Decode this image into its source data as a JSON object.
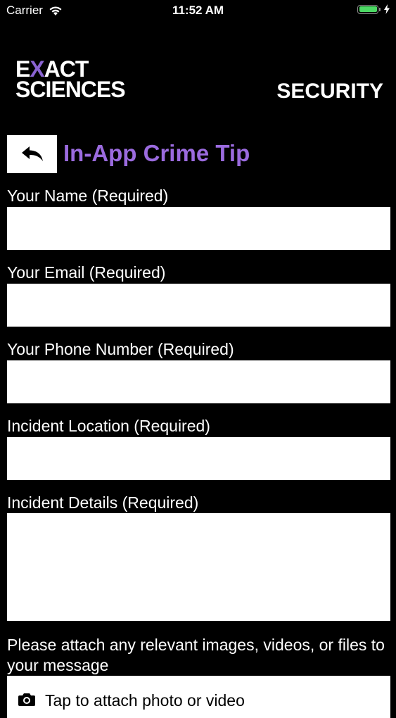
{
  "status_bar": {
    "carrier": "Carrier",
    "time": "11:52 AM",
    "battery_level": 1.0
  },
  "header": {
    "logo_line1_pre": "E",
    "logo_line1_x": "X",
    "logo_line1_post": "ACT",
    "logo_line2": "SCIENCES",
    "section": "SECURITY"
  },
  "page": {
    "back_icon": "reply-arrow-icon",
    "title": "In-App Crime Tip"
  },
  "form": {
    "name_label": "Your Name (Required)",
    "name_value": "",
    "email_label": "Your Email (Required)",
    "email_value": "",
    "phone_label": "Your Phone Number (Required)",
    "phone_value": "",
    "location_label": "Incident Location (Required)",
    "location_value": "",
    "details_label": "Incident Details (Required)",
    "details_value": "",
    "attach_note": "Please attach any relevant images, videos, or files to your message",
    "attach_button": "Tap to attach photo or video",
    "attach_icon": "camera-icon"
  },
  "colors": {
    "background": "#000000",
    "accent": "#9b6bdf",
    "battery": "#4cd964"
  }
}
